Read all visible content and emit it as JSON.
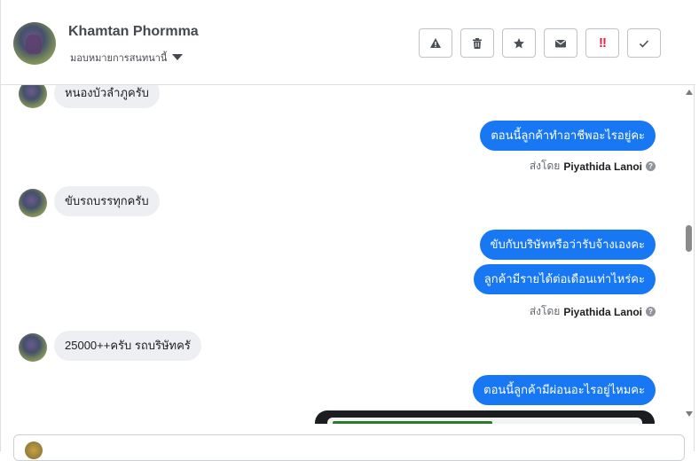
{
  "header": {
    "name": "Khamtan Phormma",
    "assign_label": "มอบหมายการสนทนานี้",
    "actions": [
      {
        "icon": "warning-icon",
        "symbol": "⚠"
      },
      {
        "icon": "trash-icon",
        "symbol": "🗑"
      },
      {
        "icon": "star-icon",
        "symbol": "★"
      },
      {
        "icon": "mail-icon",
        "symbol": "✉"
      },
      {
        "icon": "urgent-icon",
        "symbol": "‼"
      },
      {
        "icon": "check-icon",
        "symbol": "✓"
      }
    ]
  },
  "messages": {
    "m1": "หนองบัวลำภูครับ",
    "m2": "ตอนนี้ลูกค้าทำอาชีพอะไรอยู่คะ",
    "sent1_prefix": "ส่งโดย",
    "sent1_name": "Piyathida Lanoi",
    "m3": "ขับรถบรรทุกครับ",
    "m4": "ขับกับบริษัทหรือว่ารับจ้างเองคะ",
    "m5": "ลูกค้ามีรายได้ต่อเดือนเท่าไหร่คะ",
    "sent2_prefix": "ส่งโดย",
    "sent2_name": "Piyathida Lanoi",
    "m6": "25000++ครับ รถบริษัทครั",
    "m7": "ตอนนี้ลูกค้ามีผ่อนอะไรอยู่ไหมคะ"
  },
  "colors": {
    "accent": "#1877f2",
    "incoming_bubble": "#eeeff2",
    "text": "#1c1e21"
  }
}
